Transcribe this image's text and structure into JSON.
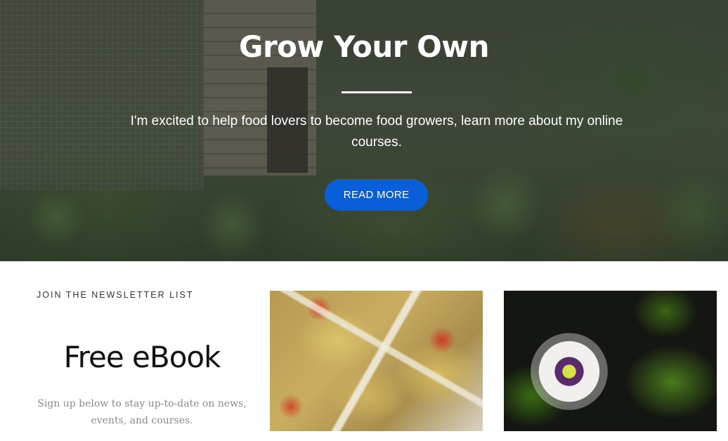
{
  "hero": {
    "title": "Grow Your Own",
    "subtitle": "I'm excited to help food lovers to become food growers, learn more about my online courses.",
    "button_label": "READ MORE"
  },
  "newsletter": {
    "eyebrow": "JOIN THE NEWSLETTER LIST",
    "title": "Free eBook",
    "description": "Sign up below to stay up-to-date on news, events, and courses."
  },
  "images": [
    {
      "icon": "food-photo"
    },
    {
      "icon": "passionflower-photo"
    }
  ],
  "colors": {
    "button": "#0a5fd8",
    "text_muted": "#8a8a8a"
  }
}
